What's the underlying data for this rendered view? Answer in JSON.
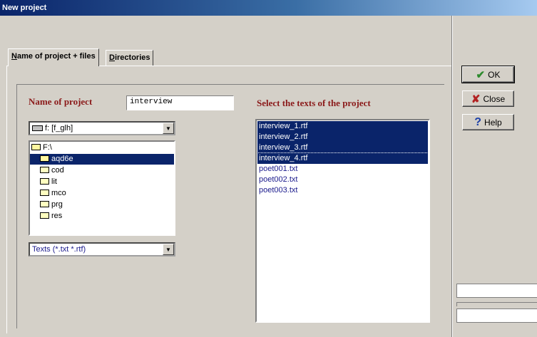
{
  "window": {
    "title": "New project"
  },
  "tabs": [
    {
      "label_underlined": "N",
      "label_rest": "ame of project + files"
    },
    {
      "label_underlined": "D",
      "label_rest": "irectories"
    }
  ],
  "project": {
    "name_label": "Name of project",
    "name_value": "interview"
  },
  "drive_combo": {
    "value": "f: [f_glh]"
  },
  "folder_tree": [
    {
      "label": "F:\\",
      "level": 0,
      "open": true,
      "selected": false
    },
    {
      "label": "aqd6e",
      "level": 1,
      "open": true,
      "selected": true
    },
    {
      "label": "cod",
      "level": 1,
      "open": false,
      "selected": false
    },
    {
      "label": "lit",
      "level": 1,
      "open": false,
      "selected": false
    },
    {
      "label": "mco",
      "level": 1,
      "open": false,
      "selected": false
    },
    {
      "label": "prg",
      "level": 1,
      "open": false,
      "selected": false
    },
    {
      "label": "res",
      "level": 1,
      "open": false,
      "selected": false
    }
  ],
  "filter_combo": {
    "value": "Texts (*.txt *.rtf)"
  },
  "texts": {
    "label": "Select the texts of the project",
    "items": [
      {
        "name": "interview_1.rtf",
        "selected": true
      },
      {
        "name": "interview_2.rtf",
        "selected": true
      },
      {
        "name": "interview_3.rtf",
        "selected": true
      },
      {
        "name": "interview_4.rtf",
        "selected": true
      },
      {
        "name": "poet001.txt",
        "selected": false
      },
      {
        "name": "poet002.txt",
        "selected": false
      },
      {
        "name": "poet003.txt",
        "selected": false
      }
    ]
  },
  "buttons": {
    "ok": {
      "label": "OK",
      "icon": "checkmark-icon",
      "color": "#2e8b2e"
    },
    "close": {
      "label": "Close",
      "icon": "x-icon",
      "color": "#b22222"
    },
    "help": {
      "label": "Help",
      "icon": "question-icon",
      "color": "#1a3ea8"
    }
  },
  "colors": {
    "titlebar_start": "#0a246a",
    "selection": "#0a246a",
    "label_red": "#8b1a1a",
    "file_text": "#1a1a8c"
  }
}
